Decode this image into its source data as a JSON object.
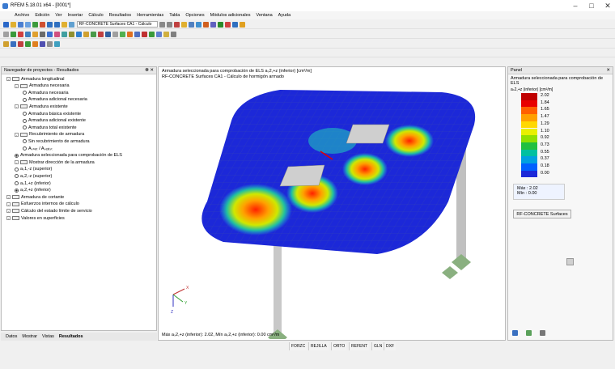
{
  "window": {
    "title": "RFEM 5.18.01 x64 - [0001*]",
    "min": "–",
    "max": "□",
    "close": "✕"
  },
  "menu": [
    "Archivo",
    "Edición",
    "Ver",
    "Insertar",
    "Cálculo",
    "Resultados",
    "Herramientas",
    "Tabla",
    "Opciones",
    "Módulos adicionales",
    "Ventana",
    "Ayuda"
  ],
  "toolbar": {
    "case_combo": "RF-CONCRETE Surfaces CA1 - Cálculo"
  },
  "navigator": {
    "title": "Navegador de proyectos - Resultados",
    "pin": "❁ ✕",
    "items": [
      {
        "label": "Armadura longitudinal",
        "kind": "check",
        "indent": 0
      },
      {
        "label": "Armadura necesaria",
        "kind": "check",
        "indent": 1
      },
      {
        "label": "Armadura necesaria",
        "kind": "radio",
        "indent": 2,
        "selected": false
      },
      {
        "label": "Armadura adicional necesaria",
        "kind": "radio",
        "indent": 2,
        "selected": false
      },
      {
        "label": "Armadura existente",
        "kind": "check",
        "indent": 1
      },
      {
        "label": "Armadura básica existente",
        "kind": "radio",
        "indent": 2,
        "selected": false
      },
      {
        "label": "Armadura adicional existente",
        "kind": "radio",
        "indent": 2,
        "selected": false
      },
      {
        "label": "Armadura total existente",
        "kind": "radio",
        "indent": 2,
        "selected": false
      },
      {
        "label": "Recubrimiento de armadura",
        "kind": "check",
        "indent": 1
      },
      {
        "label": "Sin recubrimiento de armadura",
        "kind": "radio",
        "indent": 2,
        "selected": false
      },
      {
        "label": "Aₛₙₑₜ / Aₛₑₓᵢₛₜ",
        "kind": "radio",
        "indent": 2,
        "selected": false
      },
      {
        "label": "Armadura seleccionada para comprobación de ELS",
        "kind": "radio",
        "indent": 1,
        "selected": true
      },
      {
        "label": "Mostrar dirección de la armadura",
        "kind": "check",
        "indent": 1
      },
      {
        "label": "aₛ1,-z (superior)",
        "kind": "radio",
        "indent": 1,
        "selected": false
      },
      {
        "label": "aₛ2,-z (superior)",
        "kind": "radio",
        "indent": 1,
        "selected": false
      },
      {
        "label": "aₛ1,+z (inferior)",
        "kind": "radio",
        "indent": 1,
        "selected": false
      },
      {
        "label": "aₛ2,+z (inferior)",
        "kind": "radio",
        "indent": 1,
        "selected": true
      },
      {
        "label": "Armadura de cortante",
        "kind": "check",
        "indent": 0
      },
      {
        "label": "Esfuerzos internos de cálculo",
        "kind": "check",
        "indent": 0
      },
      {
        "label": "Cálculo del estado límite de servicio",
        "kind": "check",
        "indent": 0
      },
      {
        "label": "Valores en superficies",
        "kind": "check",
        "indent": 0
      }
    ],
    "tabs": [
      "Datos",
      "Mostrar",
      "Vistas",
      "Resultados"
    ]
  },
  "view": {
    "line1": "Armadura seleccionada para comprobación de ELS aₛ2,+z (inferior) [cm²/m]",
    "line2": "RF-CONCRETE Surfaces CA1 - Cálculo de hormigón armado",
    "footer": "Máx aₛ2,+z (inferior): 2.02, Mín aₛ2,+z (inferior): 0.00 cm²/m",
    "axis_x": "X",
    "axis_y": "Y",
    "axis_z": "Z"
  },
  "panel": {
    "title": "Panel",
    "pin": "✕",
    "heading": "Armadura seleccionada para comprobación de ELS",
    "sub": "aₛ2,+z (inferior) [cm²/m]",
    "legend": [
      {
        "v": "2.02",
        "c": "#c00000"
      },
      {
        "v": "1.84",
        "c": "#e80000"
      },
      {
        "v": "1.65",
        "c": "#ff6000"
      },
      {
        "v": "1.47",
        "c": "#ffa000"
      },
      {
        "v": "1.29",
        "c": "#ffd800"
      },
      {
        "v": "1.10",
        "c": "#e8f000"
      },
      {
        "v": "0.92",
        "c": "#90e000"
      },
      {
        "v": "0.73",
        "c": "#20c040"
      },
      {
        "v": "0.55",
        "c": "#00c0a0"
      },
      {
        "v": "0.37",
        "c": "#00a0e0"
      },
      {
        "v": "0.18",
        "c": "#0060ff"
      },
      {
        "v": "0.00",
        "c": "#1c28d8"
      }
    ],
    "max_label": "Máx :",
    "max_val": "2.02",
    "min_label": "Mín :",
    "min_val": "0.00",
    "button": "RF-CONCRETE Surfaces"
  },
  "status": [
    "FORZC",
    "REJILLA",
    "ORTO",
    "REFENT",
    "GLN",
    "DXF"
  ]
}
